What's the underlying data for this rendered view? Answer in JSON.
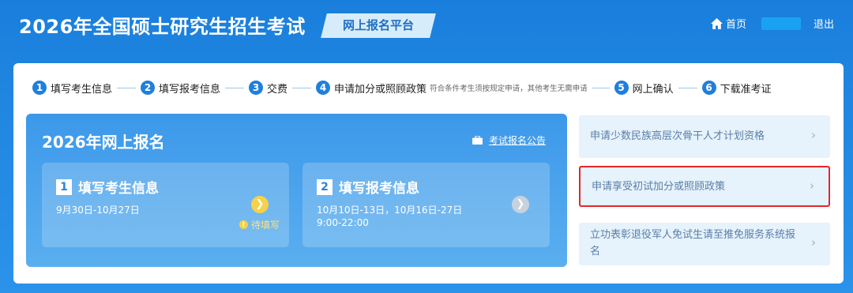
{
  "header": {
    "site_title": "2026年全国硕士研究生招生考试",
    "platform_label": "网上报名平台",
    "home_label": "首页",
    "logout_label": "退出",
    "icons": {
      "home": "home-icon"
    }
  },
  "steps": [
    {
      "num": "1",
      "label": "填写考生信息"
    },
    {
      "num": "2",
      "label": "填写报考信息"
    },
    {
      "num": "3",
      "label": "交费"
    },
    {
      "num": "4",
      "label": "申请加分或照顾政策",
      "note": "符合条件考生须按规定申请，其他考生无需申请"
    },
    {
      "num": "5",
      "label": "网上确认"
    },
    {
      "num": "6",
      "label": "下载准考证"
    }
  ],
  "registration": {
    "title": "2026年网上报名",
    "notice_link": "考试报名公告",
    "cards": [
      {
        "num": "1",
        "title": "填写考生信息",
        "date": "9月30日-10月27日",
        "status": "待填写"
      },
      {
        "num": "2",
        "title": "填写报考信息",
        "date": "10月10日-13日，10月16日-27日",
        "time": "9:00-22:00"
      }
    ]
  },
  "options": [
    {
      "label": "申请少数民族高层次骨干人才计划资格"
    },
    {
      "label": "申请享受初试加分或照顾政策"
    },
    {
      "label": "立功表彰退役军人免试生请至推免服务系统报名"
    }
  ],
  "colors": {
    "header_bg": "#1f86df",
    "step_accent": "#1f7fdc",
    "highlight_border": "#e5262b",
    "pending": "#f7d14a"
  }
}
